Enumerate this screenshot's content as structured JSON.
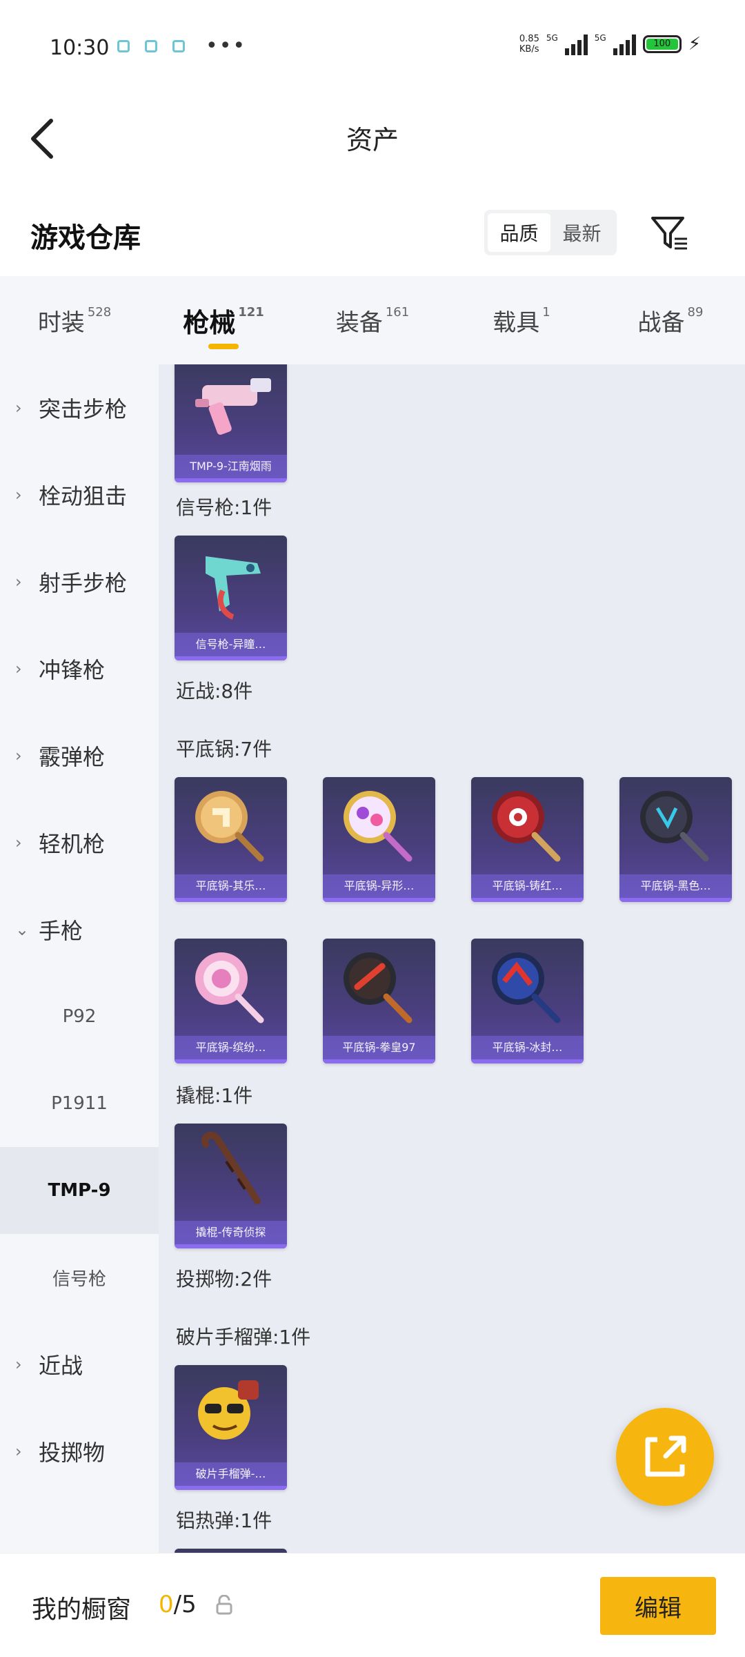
{
  "status_bar": {
    "time": "10:30",
    "net_speed": "0.85",
    "net_unit": "KB/s",
    "network": "5G",
    "network2": "5G",
    "battery": "100",
    "more": "•••"
  },
  "header": {
    "title": "资产",
    "subtitle": "游戏仓库",
    "sort_options": [
      "品质",
      "最新"
    ],
    "selected_sort": "品质"
  },
  "tabs": [
    {
      "label": "时装",
      "count": "528"
    },
    {
      "label": "枪械",
      "count": "121",
      "active": true
    },
    {
      "label": "装备",
      "count": "161"
    },
    {
      "label": "载具",
      "count": "1"
    },
    {
      "label": "战备",
      "count": "89"
    }
  ],
  "sidebar": {
    "items": [
      {
        "label": "突击步枪",
        "chevron": "›"
      },
      {
        "label": "栓动狙击",
        "chevron": "›"
      },
      {
        "label": "射手步枪",
        "chevron": "›"
      },
      {
        "label": "冲锋枪",
        "chevron": "›"
      },
      {
        "label": "霰弹枪",
        "chevron": "›"
      },
      {
        "label": "轻机枪",
        "chevron": "›"
      },
      {
        "label": "手枪",
        "chevron": "⌄"
      },
      {
        "label": "P92"
      },
      {
        "label": "P1911"
      },
      {
        "label": "TMP-9",
        "selected": true
      },
      {
        "label": "信号枪"
      },
      {
        "label": "近战",
        "chevron": "›"
      },
      {
        "label": "投掷物",
        "chevron": "›"
      }
    ]
  },
  "content": {
    "sections": [
      {
        "label": "信号枪:1件"
      },
      {
        "label": "近战:8件"
      },
      {
        "label": "平底锅:7件"
      },
      {
        "label": "撬棍:1件"
      },
      {
        "label": "投掷物:2件"
      },
      {
        "label": "破片手榴弹:1件"
      },
      {
        "label": "铝热弹:1件"
      }
    ],
    "cards": [
      {
        "caption": "TMP-9-江南烟雨",
        "icon": "smg-pink-icon"
      },
      {
        "caption": "信号枪-异瞳…",
        "icon": "flare-gun-icon"
      },
      {
        "caption": "平底锅-其乐…",
        "icon": "pan-golden-icon"
      },
      {
        "caption": "平底锅-异形…",
        "icon": "pan-colorful-icon"
      },
      {
        "caption": "平底锅-铸红…",
        "icon": "pan-red-icon"
      },
      {
        "caption": "平底锅-黑色…",
        "icon": "pan-black-icon"
      },
      {
        "caption": "平底锅-缤纷…",
        "icon": "pan-lollipop-icon"
      },
      {
        "caption": "平底锅-拳皇97",
        "icon": "pan-kof-icon"
      },
      {
        "caption": "平底锅-冰封…",
        "icon": "pan-ice-icon"
      },
      {
        "caption": "撬棍-传奇侦探",
        "icon": "crowbar-icon"
      },
      {
        "caption": "破片手榴弹-…",
        "icon": "grenade-icon"
      }
    ]
  },
  "bottom_bar": {
    "label": "我的橱窗",
    "current": "0",
    "total": "/5",
    "edit_label": "编辑"
  },
  "colors": {
    "accent": "#f7b60f",
    "card_bg": "#4b3f80",
    "sidebar_bg": "#f4f6fa",
    "content_bg": "#e9ecf2"
  }
}
